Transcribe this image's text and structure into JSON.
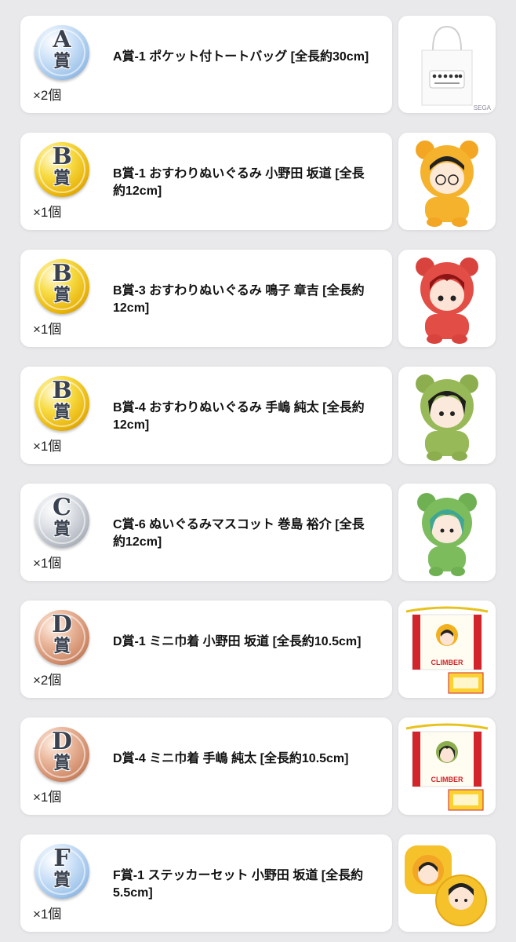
{
  "prizes": [
    {
      "medal_letter": "A",
      "medal_kanji": "賞",
      "medal_color": "#bcd6f3",
      "title": "A賞-1 ポケット付トートバッグ [全長約30cm]",
      "quantity": "×2個",
      "image_icon": "tote-bag-icon",
      "thumb_text": "SEGA"
    },
    {
      "medal_letter": "B",
      "medal_kanji": "賞",
      "medal_color": "#f5cc23",
      "title": "B賞-1 おすわりぬいぐるみ 小野田 坂道 [全長約12cm]",
      "quantity": "×1個",
      "image_icon": "plush-yellow-icon"
    },
    {
      "medal_letter": "B",
      "medal_kanji": "賞",
      "medal_color": "#f5cc23",
      "title": "B賞-3 おすわりぬいぐるみ 鳴子 章吉 [全長約12cm]",
      "quantity": "×1個",
      "image_icon": "plush-red-icon"
    },
    {
      "medal_letter": "B",
      "medal_kanji": "賞",
      "medal_color": "#f5cc23",
      "title": "B賞-4 おすわりぬいぐるみ 手嶋 純太 [全長約12cm]",
      "quantity": "×1個",
      "image_icon": "plush-green-icon"
    },
    {
      "medal_letter": "C",
      "medal_kanji": "賞",
      "medal_color": "#c8ccd3",
      "title": "C賞-6 ぬいぐるみマスコット 巻島 裕介 [全長約12cm]",
      "quantity": "×1個",
      "image_icon": "plush-mascot-green-icon"
    },
    {
      "medal_letter": "D",
      "medal_kanji": "賞",
      "medal_color": "#e2a688",
      "title": "D賞-1 ミニ巾着 小野田 坂道 [全長約10.5cm]",
      "quantity": "×2個",
      "image_icon": "drawstring-bag-icon",
      "thumb_text": "CLIMBER"
    },
    {
      "medal_letter": "D",
      "medal_kanji": "賞",
      "medal_color": "#e2a688",
      "title": "D賞-4 ミニ巾着 手嶋 純太 [全長約10.5cm]",
      "quantity": "×1個",
      "image_icon": "drawstring-bag-icon",
      "thumb_text": "CLIMBER"
    },
    {
      "medal_letter": "F",
      "medal_kanji": "賞",
      "medal_color": "#bcd6f3",
      "title": "F賞-1 ステッカーセット 小野田 坂道 [全長約5.5cm]",
      "quantity": "×1個",
      "image_icon": "sticker-set-icon"
    }
  ]
}
